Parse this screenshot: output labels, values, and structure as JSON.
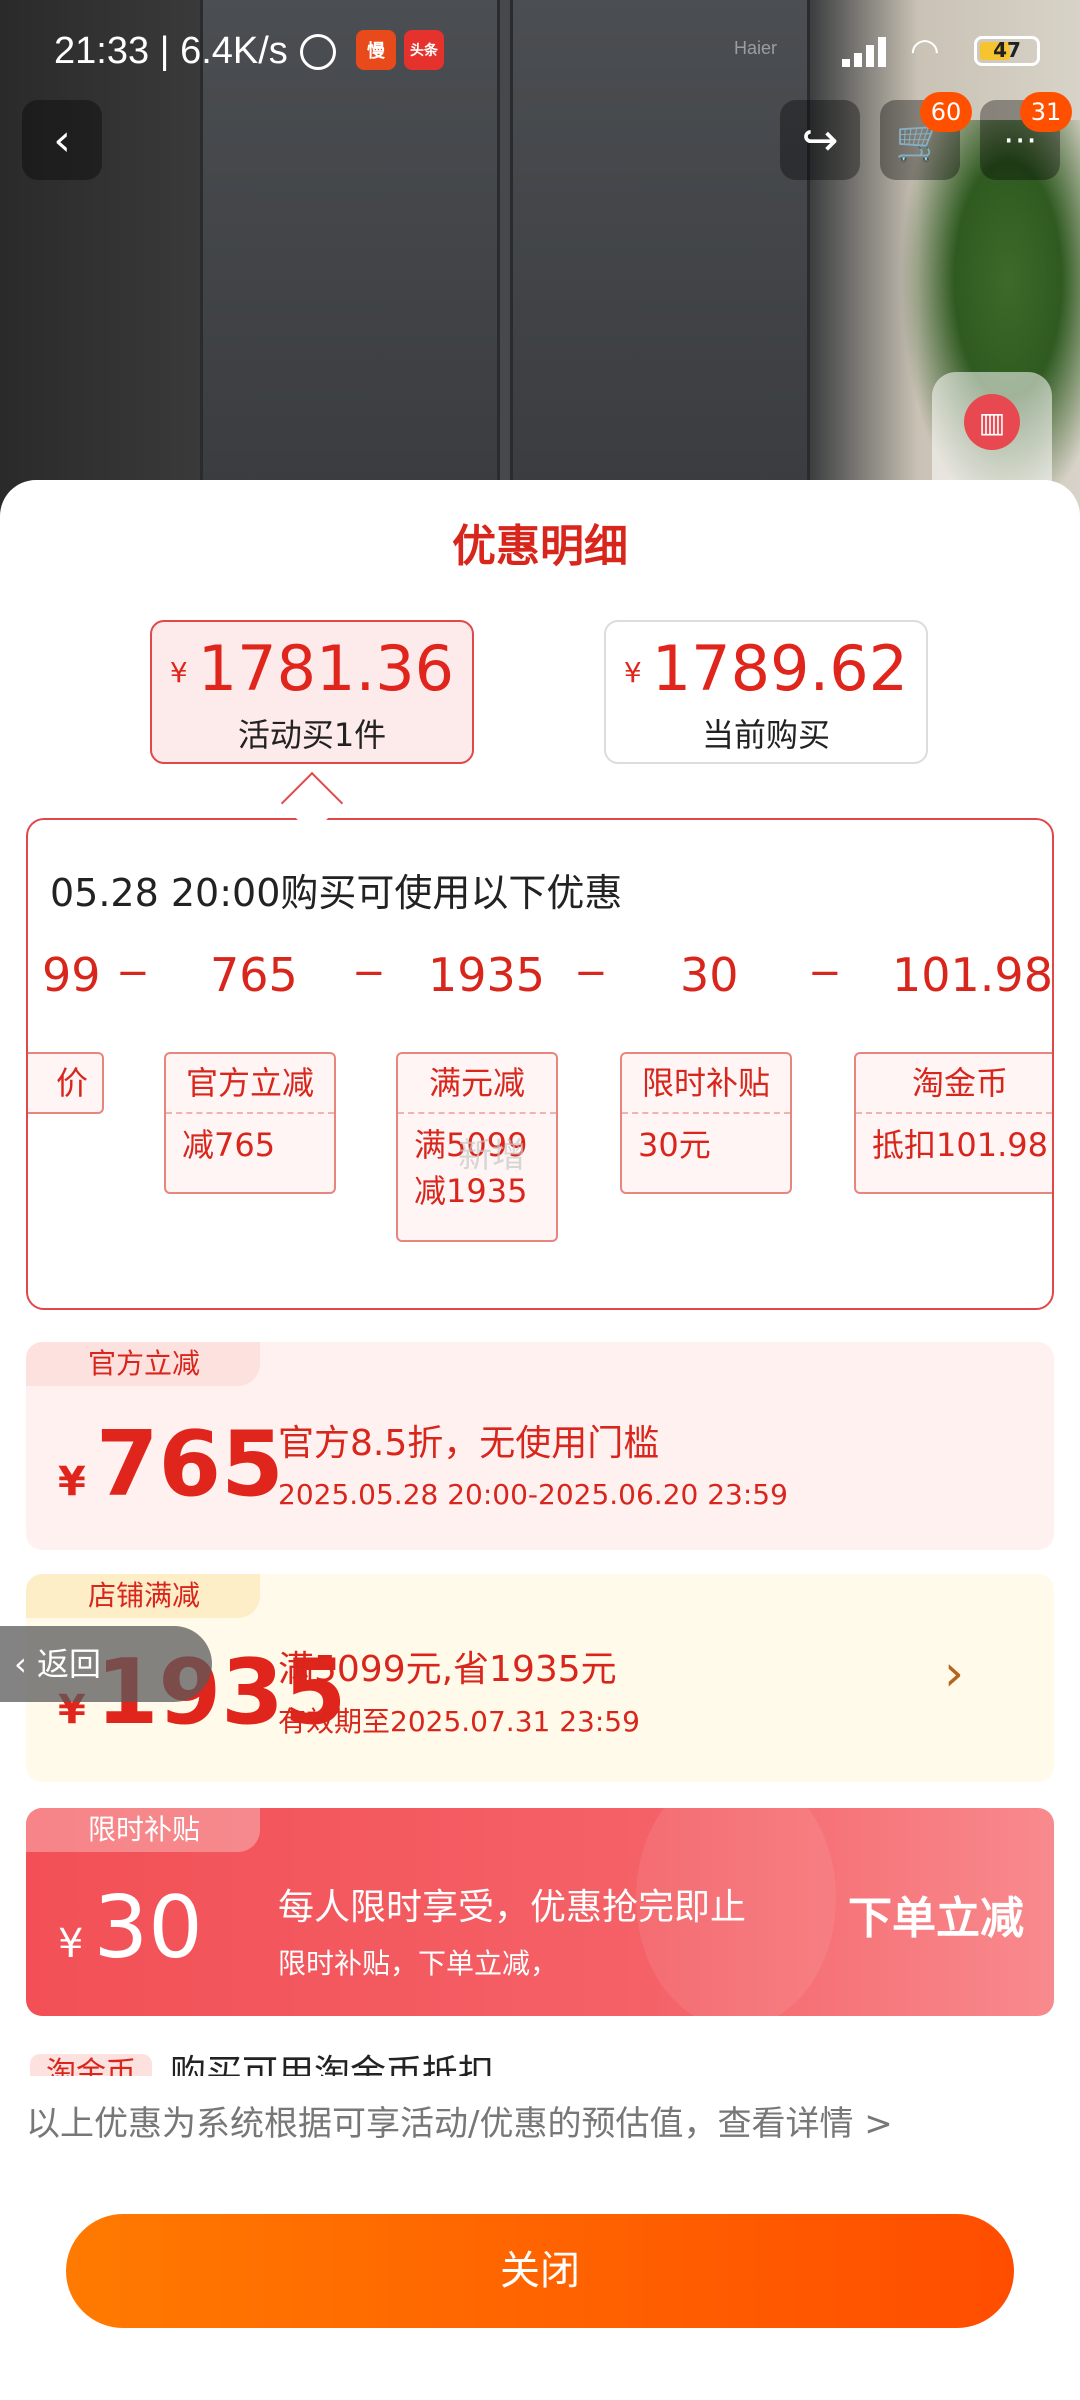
{
  "status_bar": {
    "time": "21:33 | 6.4K/s",
    "app_icon_1": "慢",
    "app_icon_2": "头条",
    "battery": "47"
  },
  "nav": {
    "back_icon": "‹",
    "share_icon": "↪",
    "cart_icon": "🛒",
    "cart_badge": "60",
    "more_badge": "31"
  },
  "photo": {
    "brand": "Haier"
  },
  "sheet": {
    "title": "优惠明细",
    "tabs": [
      {
        "currency": "¥",
        "price": "1781.36",
        "label": "活动买1件",
        "active": true
      },
      {
        "currency": "¥",
        "price": "1789.62",
        "label": "当前购买",
        "active": false
      }
    ],
    "detail": {
      "heading": "05.28 20:00购买可使用以下优惠",
      "flow": [
        "99",
        "765",
        "1935",
        "30",
        "101.98"
      ],
      "operator": "−",
      "chips": [
        {
          "title": "价",
          "value": ""
        },
        {
          "title": "官方立减",
          "value": "减765"
        },
        {
          "title": "满元减",
          "value": "满5099",
          "value2": "减1935"
        },
        {
          "title": "限时补贴",
          "value": "30元"
        },
        {
          "title": "淘金币",
          "value": "抵扣101.98"
        }
      ],
      "watermark": "新增"
    },
    "coupons": [
      {
        "tag": "官方立减",
        "currency": "¥",
        "amount": "765",
        "title": "官方8.5折，无使用门槛",
        "subtitle": "2025.05.28 20:00-2025.06.20 23:59"
      },
      {
        "tag": "店铺满减",
        "currency": "¥",
        "amount": "1935",
        "title": "满5099元,省1935元",
        "subtitle": "有效期至2025.07.31 23:59",
        "arrow": "›"
      },
      {
        "tag": "限时补贴",
        "currency": "¥",
        "amount": "30",
        "title": "每人限时享受，优惠抢完即止",
        "subtitle": "限时补贴，下单立减，",
        "cta": "下单立减"
      },
      {
        "tag": "淘金币",
        "title": "购买可用淘金币抵扣"
      }
    ],
    "note": "以上优惠为系统根据可享活动/优惠的预估值，查看详情 >",
    "close_label": "关闭"
  },
  "return_pill": "‹ 返回",
  "colors": {
    "accent_red": "#e0261c",
    "close_orange": "#ff5a00",
    "subsidy_red": "#f25056"
  }
}
